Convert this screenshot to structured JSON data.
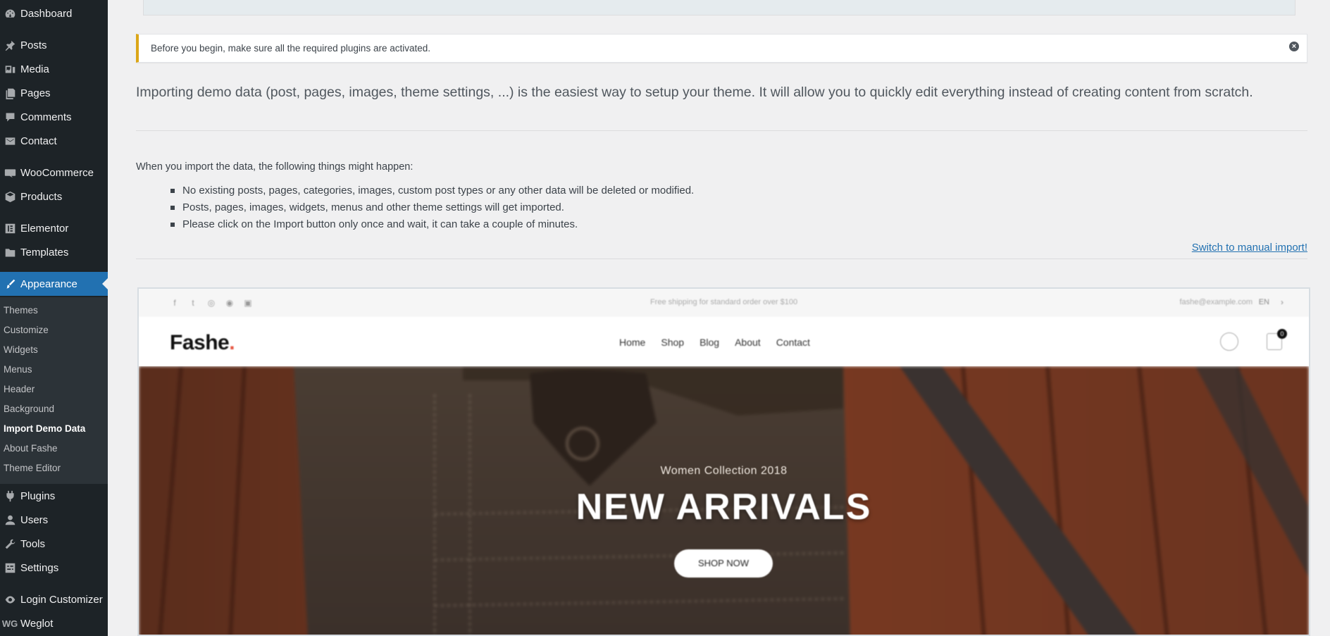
{
  "sidebar": {
    "items": [
      {
        "label": "Dashboard",
        "icon": "dashboard-icon"
      },
      {
        "label": "Posts",
        "icon": "pin-icon"
      },
      {
        "label": "Media",
        "icon": "media-icon"
      },
      {
        "label": "Pages",
        "icon": "pages-icon"
      },
      {
        "label": "Comments",
        "icon": "comment-icon"
      },
      {
        "label": "Contact",
        "icon": "mail-icon"
      },
      {
        "label": "WooCommerce",
        "icon": "woo-icon"
      },
      {
        "label": "Products",
        "icon": "box-icon"
      },
      {
        "label": "Elementor",
        "icon": "elementor-icon"
      },
      {
        "label": "Templates",
        "icon": "folder-icon"
      },
      {
        "label": "Appearance",
        "icon": "brush-icon"
      },
      {
        "label": "Plugins",
        "icon": "plugin-icon"
      },
      {
        "label": "Users",
        "icon": "user-icon"
      },
      {
        "label": "Tools",
        "icon": "wrench-icon"
      },
      {
        "label": "Settings",
        "icon": "settings-icon"
      },
      {
        "label": "Login Customizer",
        "icon": "eye-icon"
      },
      {
        "label": "Weglot",
        "icon": "weglot-icon"
      }
    ],
    "submenu": [
      "Themes",
      "Customize",
      "Widgets",
      "Menus",
      "Header",
      "Background",
      "Import Demo Data",
      "About Fashe",
      "Theme Editor"
    ],
    "active": "Appearance",
    "current_sub": "Import Demo Data"
  },
  "notice": {
    "text": "Before you begin, make sure all the required plugins are activated.",
    "close": "×"
  },
  "intro": "Importing demo data (post, pages, images, theme settings, ...) is the easiest way to setup your theme. It will allow you to quickly edit everything instead of creating content from scratch.",
  "happen": {
    "heading": "When you import the data, the following things might happen:",
    "bullets": [
      "No existing posts, pages, categories, images, custom post types or any other data will be deleted or modified.",
      "Posts, pages, images, widgets, menus and other theme settings will get imported.",
      "Please click on the Import button only once and wait, it can take a couple of minutes."
    ]
  },
  "manual_link": "Switch to manual import!",
  "preview": {
    "shipping": "Free shipping for standard order over $100",
    "email": "fashe@example.com",
    "lang": "EN",
    "logo": "Fashe",
    "logo_dot": ".",
    "nav": [
      "Home",
      "Shop",
      "Blog",
      "About",
      "Contact"
    ],
    "cart_count": "0",
    "hero_sub": "Women Collection 2018",
    "hero_title": "NEW ARRIVALS",
    "hero_button": "SHOP NOW"
  },
  "colors": {
    "sidebar_bg": "#1d2327",
    "active_bg": "#2271b1",
    "notice_border": "#dba617",
    "link": "#2271b1"
  }
}
